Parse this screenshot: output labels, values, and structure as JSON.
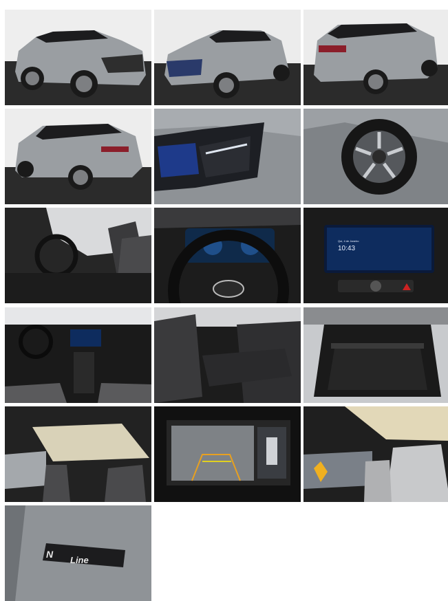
{
  "gallery": {
    "photos": [
      {
        "subject": "exterior-front-left"
      },
      {
        "subject": "exterior-front-right"
      },
      {
        "subject": "exterior-rear-left"
      },
      {
        "subject": "exterior-rear-left-wide"
      },
      {
        "subject": "headlight-closeup"
      },
      {
        "subject": "wheel-closeup"
      },
      {
        "subject": "front-cabin-seats"
      },
      {
        "subject": "steering-wheel-cluster"
      },
      {
        "subject": "infotainment-screen"
      },
      {
        "subject": "dashboard-overview"
      },
      {
        "subject": "rear-seats"
      },
      {
        "subject": "trunk-cargo"
      },
      {
        "subject": "panoramic-sunroof"
      },
      {
        "subject": "rear-camera-display"
      },
      {
        "subject": "sunroof-rear-seat"
      },
      {
        "subject": "n-line-badge"
      }
    ]
  },
  "screen": {
    "clock": "10:43",
    "day": "Qui, 4 de Janeiro"
  },
  "badge": {
    "letter": "N",
    "word": "Line"
  },
  "colors": {
    "background": "#ffffff",
    "car_body": "#9a9ea2",
    "studio_floor": "#2b2b2b",
    "roof_black": "#1c1c1e"
  }
}
